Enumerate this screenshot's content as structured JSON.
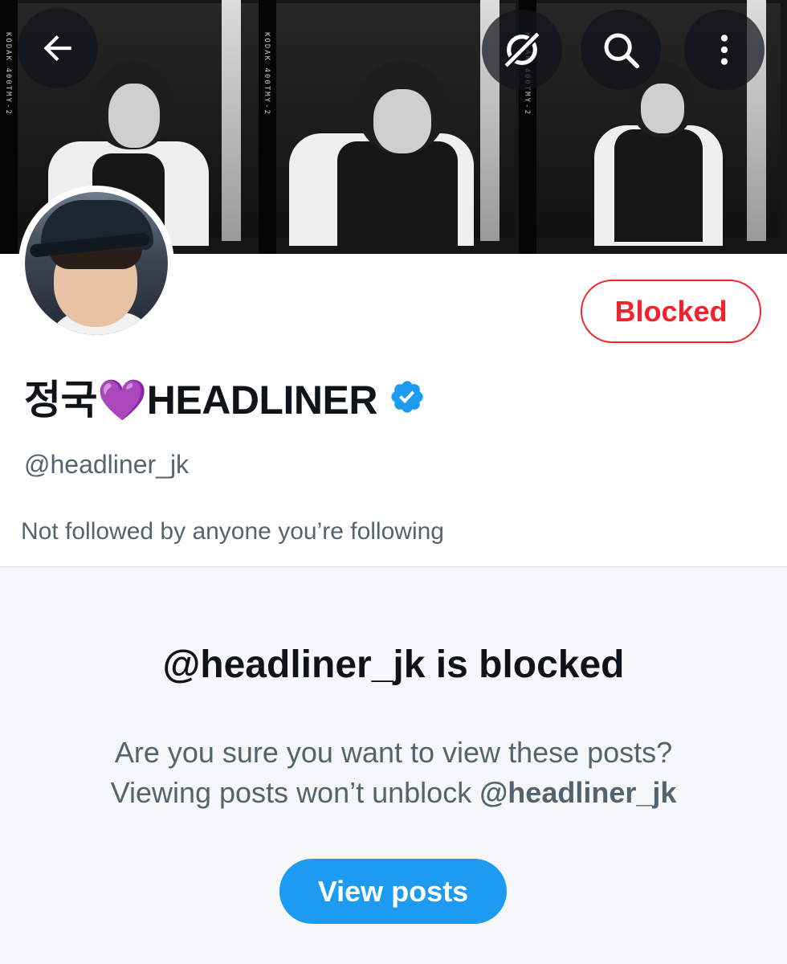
{
  "header": {
    "back_icon": "arrow-left-icon",
    "grok_icon": "grok-icon",
    "search_icon": "search-icon",
    "more_icon": "more-vertical-icon"
  },
  "banner": {
    "film_edge_text": [
      "KODAK 400TMY-2",
      "KODAK 400TMY-2",
      "KODAK 400TMY-2"
    ]
  },
  "profile": {
    "display_name": "정국💜HEADLINER",
    "verified_icon": "verified-badge-icon",
    "handle": "@headliner_jk",
    "followed_note": "Not followed by anyone you’re following",
    "blocked_button_label": "Blocked"
  },
  "blocked_notice": {
    "title": "@headliner_jk is blocked",
    "line1": "Are you sure you want to view these posts?",
    "line2_prefix": "Viewing posts won’t unblock ",
    "line2_handle": "@headliner_jk",
    "view_posts_label": "View posts"
  },
  "colors": {
    "blocked_red": "#f4212e",
    "primary_blue": "#1d9bf0",
    "verified_blue": "#1d9bf0",
    "secondary_text": "#536471",
    "panel_bg": "#f5f7f8"
  }
}
